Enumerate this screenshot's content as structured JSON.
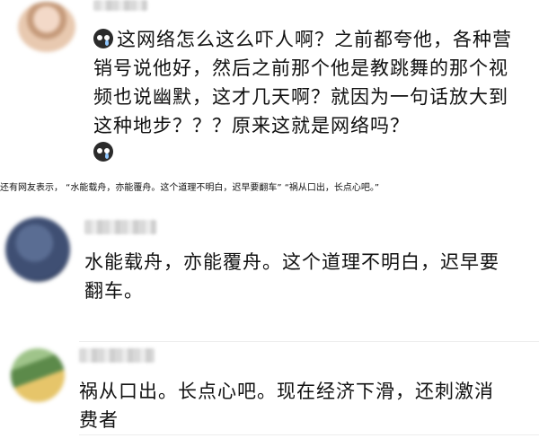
{
  "comments": [
    {
      "text": "这网络怎么这么吓人啊？之前都夸他，各种营销号说他好，然后之前那个他是教跳舞的那个视频也说幽默，这才几天啊？就因为一句话放大到这种地步？？？原来这就是网络吗？",
      "emoji_icon": "crying-face-icon"
    },
    {
      "text": "水能载舟，亦能覆舟。这个道理不明白，迟早要翻车。"
    },
    {
      "text": "祸从口出。长点心吧。现在经济下滑，还刺激消费者"
    }
  ],
  "caption": "还有网友表示，   “水能载舟，亦能覆舟。这个道理不明白，迟早要翻车”   “祸从口出，长点心吧。”"
}
